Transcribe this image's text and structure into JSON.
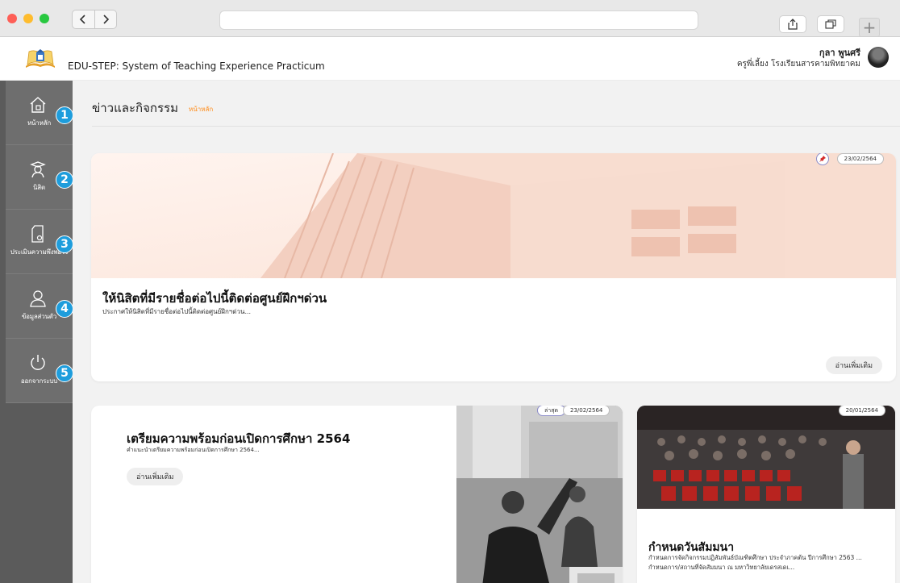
{
  "browser": {
    "back_icon": "chevron-left-icon",
    "forward_icon": "chevron-right-icon",
    "share_icon": "share-icon",
    "tabs_icon": "tabs-icon",
    "new_tab_icon": "plus-icon",
    "new_tab_label": "+"
  },
  "header": {
    "app_title": "EDU-STEP: System of Teaching Experience Practicum",
    "user_name": "กุลา พูนศรี",
    "user_role": "ครูพี่เลี้ยง โรงเรียนสารคามพิทยาคม"
  },
  "sidebar": {
    "items": [
      {
        "label": "หน้าหลัก",
        "number": "1",
        "icon": "home-icon"
      },
      {
        "label": "นิสิต",
        "number": "2",
        "icon": "student-icon"
      },
      {
        "label": "ประเมินความพึงพอใจ",
        "number": "3",
        "icon": "survey-icon"
      },
      {
        "label": "ข้อมูลส่วนตัว",
        "number": "4",
        "icon": "profile-icon"
      },
      {
        "label": "ออกจากระบบ",
        "number": "5",
        "icon": "power-icon"
      }
    ]
  },
  "main": {
    "page_title": "ข่าวและกิจกรรม",
    "breadcrumb": "หน้าหลัก",
    "hero": {
      "date": "23/02/2564",
      "title": "ให้นิสิตที่มีรายชื่อต่อไปนี้ติดต่อศูนย์ฝึกฯด่วน",
      "summary": "ประกาศให้นิสิตที่มีรายชื่อต่อไปนี้ติดต่อศูนย์ฝึกฯด่วน...",
      "read_more": "อ่านเพิ่มเติม"
    },
    "prep": {
      "badge": "ล่าสุด",
      "date": "23/02/2564",
      "title": "เตรียมความพร้อมก่อนเปิดการศึกษา 2564",
      "summary": "คำแนะนำเตรียมความพร้อมก่อนเปิดการศึกษา 2564...",
      "read_more": "อ่านเพิ่มเติม"
    },
    "seminar": {
      "date": "20/01/2564",
      "title": "กำหนดวันสัมมนา",
      "summary": "กำหนดการจัดกิจกรรมปฏิสัมพันธ์บัณฑิตศึกษา ประจำภาคต้น ปีการศึกษา 2563 ... กำหนดการ/สถานที่จัดสัมมนา ณ มหาวิทยาลัยเดรสเดเ..."
    }
  },
  "colors": {
    "sidebar_bg": "#5b5b5b",
    "sidebar_item_bg": "#6e6e6e",
    "badge_blue": "#1e9ddc",
    "breadcrumb_orange": "#ff8c1a",
    "content_bg": "#f2f2f2"
  }
}
